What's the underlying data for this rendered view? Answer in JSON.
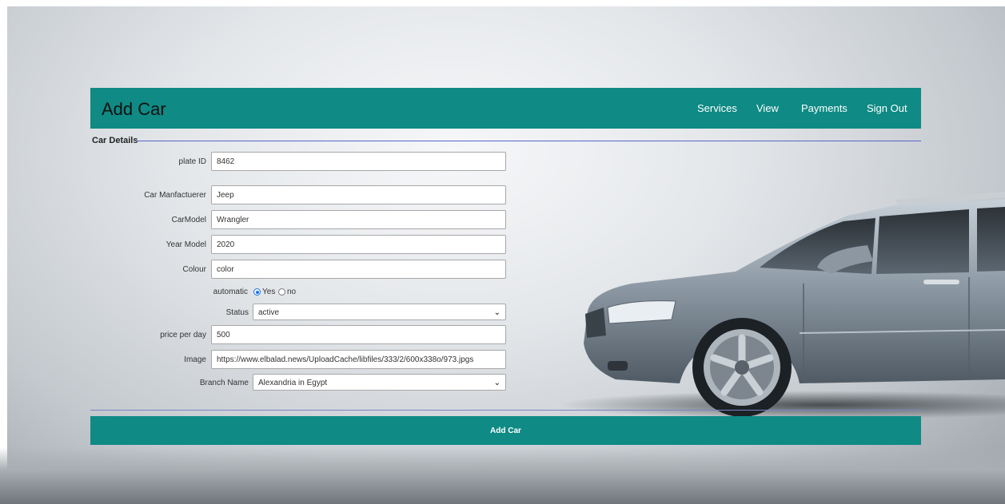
{
  "header": {
    "title": "Add Car",
    "nav": [
      "Services",
      "View",
      "Payments",
      "Sign Out"
    ]
  },
  "form": {
    "legend": "Car Details",
    "plate_id": {
      "label": "plate ID",
      "value": "8462"
    },
    "manufacturer": {
      "label": "Car Manfactuerer",
      "value": "Jeep"
    },
    "model": {
      "label": "CarModel",
      "value": "Wrangler"
    },
    "year": {
      "label": "Year Model",
      "value": "2020"
    },
    "colour": {
      "label": "Colour",
      "value": "color"
    },
    "automatic": {
      "label": "automatic",
      "yes": "Yes",
      "no": "no",
      "selected": "Yes"
    },
    "status": {
      "label": "Status",
      "value": "active"
    },
    "price": {
      "label": "price per day",
      "value": "500"
    },
    "image": {
      "label": "Image",
      "value": "https://www.elbalad.news/UploadCache/libfiles/333/2/600x338o/973.jpgs"
    },
    "branch": {
      "label": "Branch Name",
      "value": "Alexandria in Egypt"
    },
    "submit_label": "Add Car"
  },
  "colors": {
    "accent": "#0f8a84",
    "rule": "#5965c9"
  }
}
